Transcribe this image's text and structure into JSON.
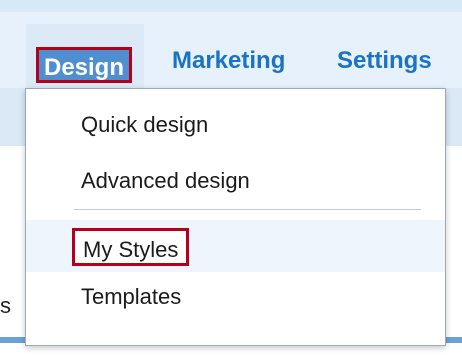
{
  "nav": {
    "design": "Design",
    "marketing": "Marketing",
    "settings": "Settings"
  },
  "background": {
    "partial_text": "s"
  },
  "menu": {
    "items": [
      {
        "label": "Quick design"
      },
      {
        "label": "Advanced design"
      },
      {
        "label": "My Styles"
      },
      {
        "label": "Templates"
      }
    ]
  },
  "colors": {
    "nav_text": "#1a73c4",
    "highlight_border": "#b4001b",
    "design_bg": "#4f8fd0"
  }
}
